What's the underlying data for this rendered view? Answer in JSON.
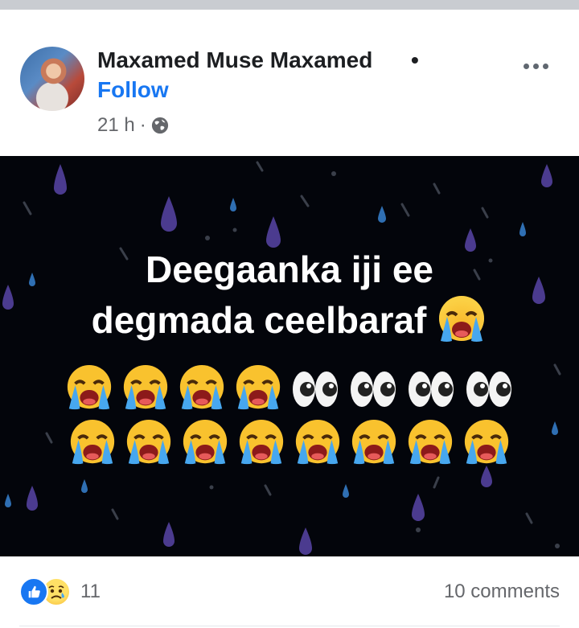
{
  "post": {
    "author_name": "Maxamed Muse Maxamed",
    "separator": "•",
    "follow_label": "Follow",
    "time": "21 h",
    "time_separator": "·",
    "privacy_icon": "globe-icon",
    "more_icon": "more-options-icon"
  },
  "image": {
    "line1": "Deegaanka iji ee",
    "line2": "degmada ceelbaraf",
    "row1_emojis": [
      "crying-face",
      "crying-face",
      "crying-face",
      "crying-face",
      "eyes",
      "eyes",
      "eyes",
      "eyes"
    ],
    "row2_emojis": [
      "crying-face",
      "crying-face",
      "crying-face",
      "crying-face",
      "crying-face",
      "crying-face",
      "crying-face",
      "crying-face"
    ],
    "background": "#03050b",
    "drop_color": "#4b3b8f"
  },
  "footer": {
    "reaction_icons": [
      "like-icon",
      "sad-icon"
    ],
    "reaction_count": "11",
    "comments_label": "10 comments"
  },
  "colors": {
    "accent": "#1877f2",
    "secondary_text": "#65676b",
    "primary_text": "#1c1e21"
  }
}
